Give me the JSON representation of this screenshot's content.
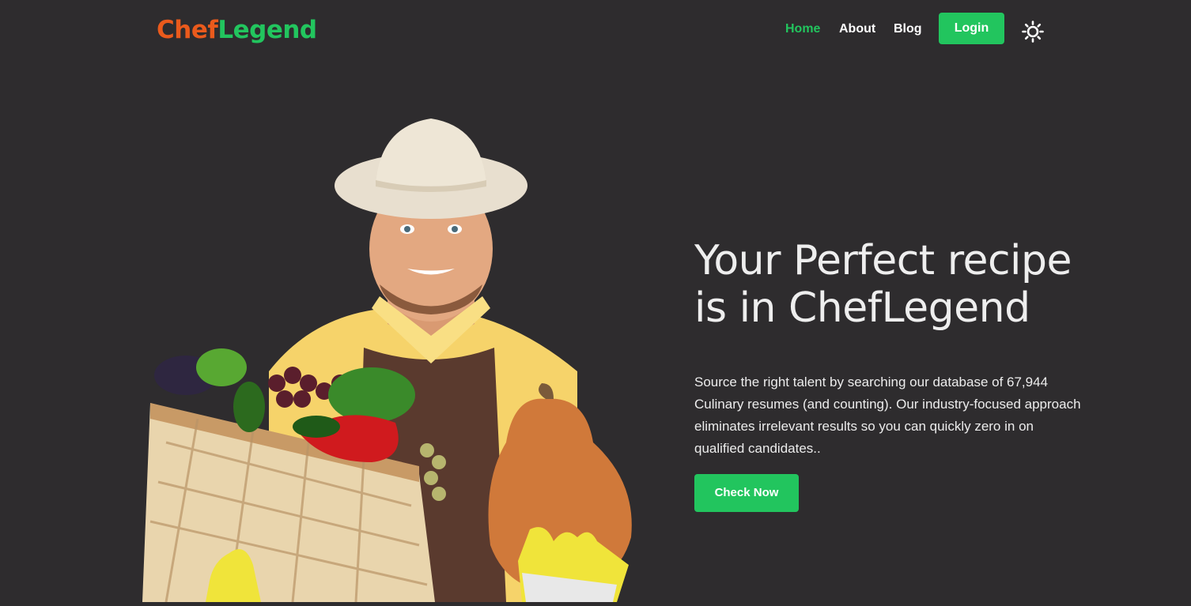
{
  "brand": {
    "part1": "Chef",
    "part2": "Legend",
    "color1": "#ea5a1c",
    "color2": "#22c55e"
  },
  "nav": {
    "links": [
      {
        "label": "Home",
        "active": true
      },
      {
        "label": "About",
        "active": false
      },
      {
        "label": "Blog",
        "active": false
      }
    ],
    "login_label": "Login",
    "theme_icon": "sun-icon"
  },
  "hero": {
    "title_line1": "Your Perfect recipe",
    "title_line2": "is in ChefLegend",
    "desc_line1": "Source the right talent by searching our database of 67,944",
    "desc_line2": "Culinary resumes (and counting). Our industry-focused approach",
    "desc_line3": "eliminates irrelevant results so you can quickly zero in on",
    "desc_line4": "qualified candidates..",
    "cta_label": "Check Now",
    "image_icon": "farmer-with-vegetables-image"
  },
  "colors": {
    "background": "#2e2c2e",
    "accent": "#22c55e",
    "text": "#eeeeee"
  }
}
